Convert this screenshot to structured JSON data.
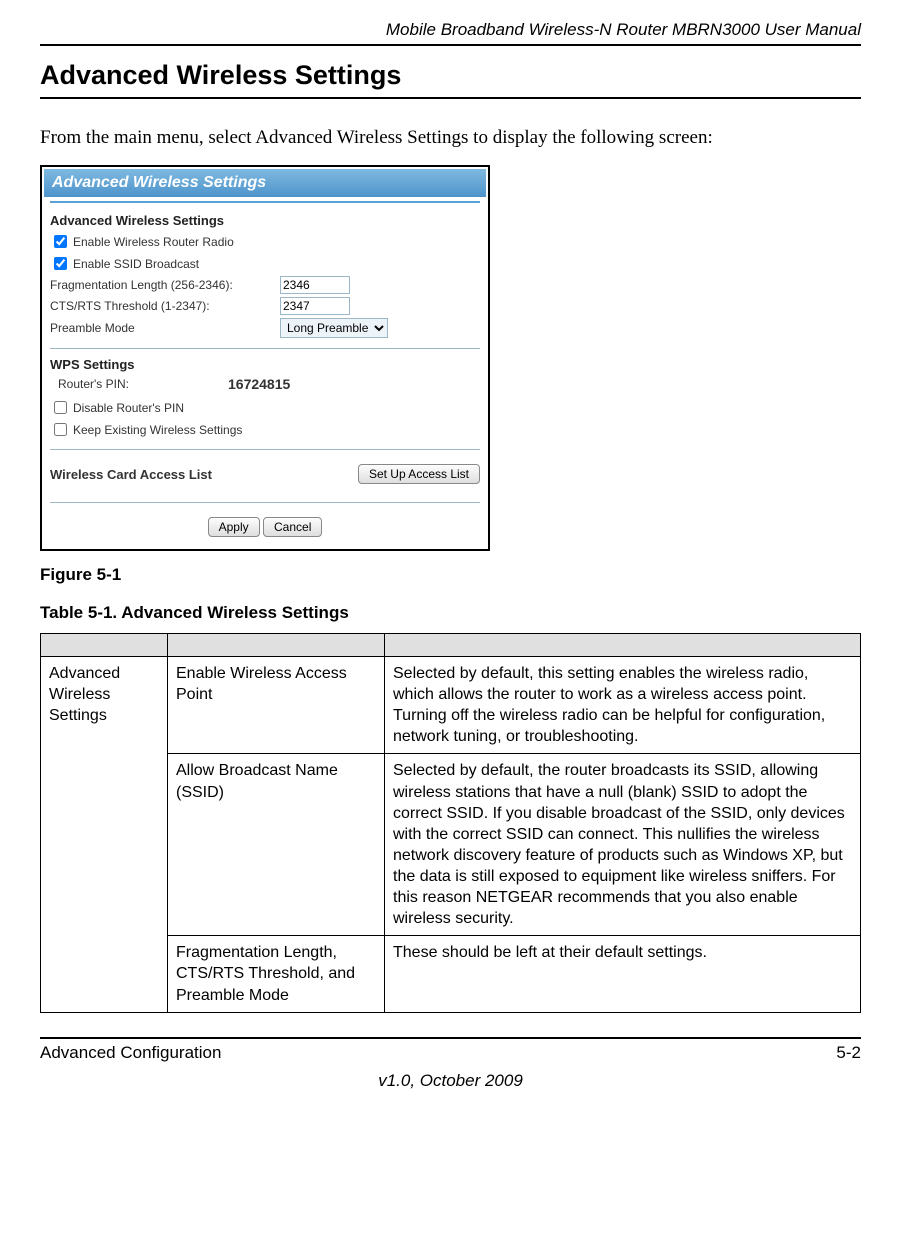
{
  "header": {
    "doc_title": "Mobile Broadband Wireless-N Router MBRN3000 User Manual"
  },
  "main": {
    "section_title": "Advanced Wireless Settings",
    "intro": "From the main menu, select Advanced Wireless Settings to display the following screen:",
    "figure_caption": "Figure 5-1",
    "table_caption": "Table 5-1.  Advanced Wireless Settings"
  },
  "screenshot": {
    "panel_title": "Advanced Wireless Settings",
    "aw_section": "Advanced Wireless Settings",
    "enable_radio_label": "Enable Wireless Router Radio",
    "enable_ssid_label": "Enable SSID Broadcast",
    "frag_label": "Fragmentation Length (256-2346):",
    "frag_value": "2346",
    "cts_label": "CTS/RTS Threshold (1-2347):",
    "cts_value": "2347",
    "preamble_label": "Preamble Mode",
    "preamble_value": "Long Preamble",
    "wps_section": "WPS Settings",
    "router_pin_label": "Router's PIN:",
    "router_pin_value": "16724815",
    "disable_pin_label": "Disable Router's PIN",
    "keep_existing_label": "Keep Existing Wireless Settings",
    "access_list_label": "Wireless Card Access List",
    "access_btn_label": "Set Up Access List",
    "apply_label": "Apply",
    "cancel_label": "Cancel"
  },
  "table": {
    "rows": [
      {
        "group": "Advanced Wireless Settings",
        "setting": "Enable Wireless Access Point",
        "desc": "Selected by default, this setting enables the wireless radio, which allows the router to work as a wireless access point. Turning off the wireless radio can be helpful for configuration, network tuning, or troubleshooting."
      },
      {
        "group": "",
        "setting": "Allow Broadcast Name (SSID)",
        "desc": "Selected by default, the router broadcasts its SSID, allowing wireless stations that have a null (blank) SSID to adopt the correct SSID. If you disable broadcast of the SSID, only devices with the correct SSID can connect. This nullifies the wireless network discovery feature of products such as Windows XP, but the data is still exposed to equipment like wireless sniffers. For this reason NETGEAR recommends that you also enable wireless security."
      },
      {
        "group": "",
        "setting": "Fragmentation Length, CTS/RTS Threshold, and Preamble Mode",
        "desc": "These should be left at their default settings."
      }
    ]
  },
  "footer": {
    "left": "Advanced Configuration",
    "right": "5-2",
    "version": "v1.0, October 2009"
  }
}
